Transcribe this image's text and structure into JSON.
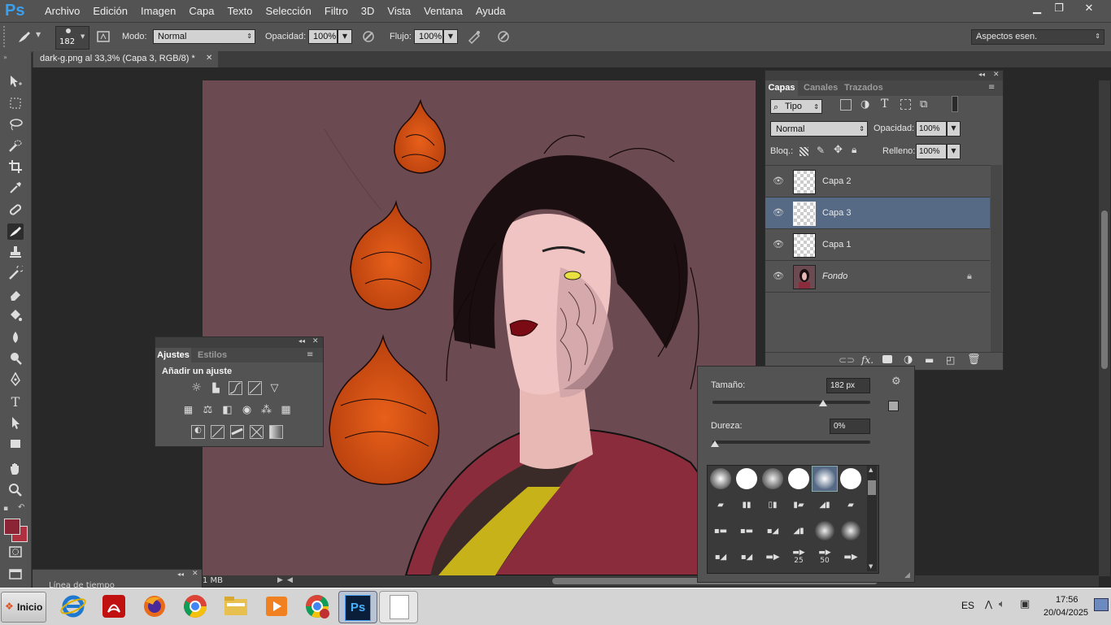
{
  "app": {
    "logo": "Ps"
  },
  "menu": [
    "Archivo",
    "Edición",
    "Imagen",
    "Capa",
    "Texto",
    "Selección",
    "Filtro",
    "3D",
    "Vista",
    "Ventana",
    "Ayuda"
  ],
  "window_buttons": {
    "minimize": "▁",
    "restore": "❐",
    "close": "✕"
  },
  "options_bar": {
    "brush_size": "182",
    "mode_label": "Modo:",
    "mode_value": "Normal",
    "opacity_label": "Opacidad:",
    "opacity_value": "100%",
    "flow_label": "Flujo:",
    "flow_value": "100%",
    "workspace_value": "Aspectos esen."
  },
  "document_tab": {
    "title": "dark-g.png al 33,3% (Capa 3, RGB/8) *",
    "close": "✕"
  },
  "colors": {
    "foreground": "#8b2535",
    "background": "#b03040",
    "ui_dark": "#535353",
    "selected_layer": "#566a86",
    "canvas_bg": "#6b4a52"
  },
  "status": {
    "doc_size": "1 MB",
    "timeline_label": "Línea de tiempo"
  },
  "layers_panel": {
    "tabs": [
      "Capas",
      "Canales",
      "Trazados"
    ],
    "filter_value": "Tipo",
    "blend_mode": "Normal",
    "opacity_label": "Opacidad:",
    "opacity_value": "100%",
    "lock_label": "Bloq.:",
    "fill_label": "Relleno:",
    "fill_value": "100%",
    "layers": [
      {
        "name": "Capa 2",
        "selected": false,
        "italic": false
      },
      {
        "name": "Capa 3",
        "selected": true,
        "italic": false
      },
      {
        "name": "Capa 1",
        "selected": false,
        "italic": false
      },
      {
        "name": "Fondo",
        "selected": false,
        "italic": true,
        "locked": true
      }
    ]
  },
  "adjustments_panel": {
    "tabs": [
      "Ajustes",
      "Estilos"
    ],
    "title": "Añadir un ajuste"
  },
  "brush_picker": {
    "size_label": "Tamaño:",
    "size_value": "182 px",
    "size_fraction": 0.7,
    "hardness_label": "Dureza:",
    "hardness_value": "0%",
    "hardness_fraction": 0.0,
    "brush_numbers": [
      "25",
      "50"
    ]
  },
  "taskbar": {
    "start_label": "Inicio",
    "language": "ES",
    "time": "17:56",
    "date": "20/04/2025"
  }
}
